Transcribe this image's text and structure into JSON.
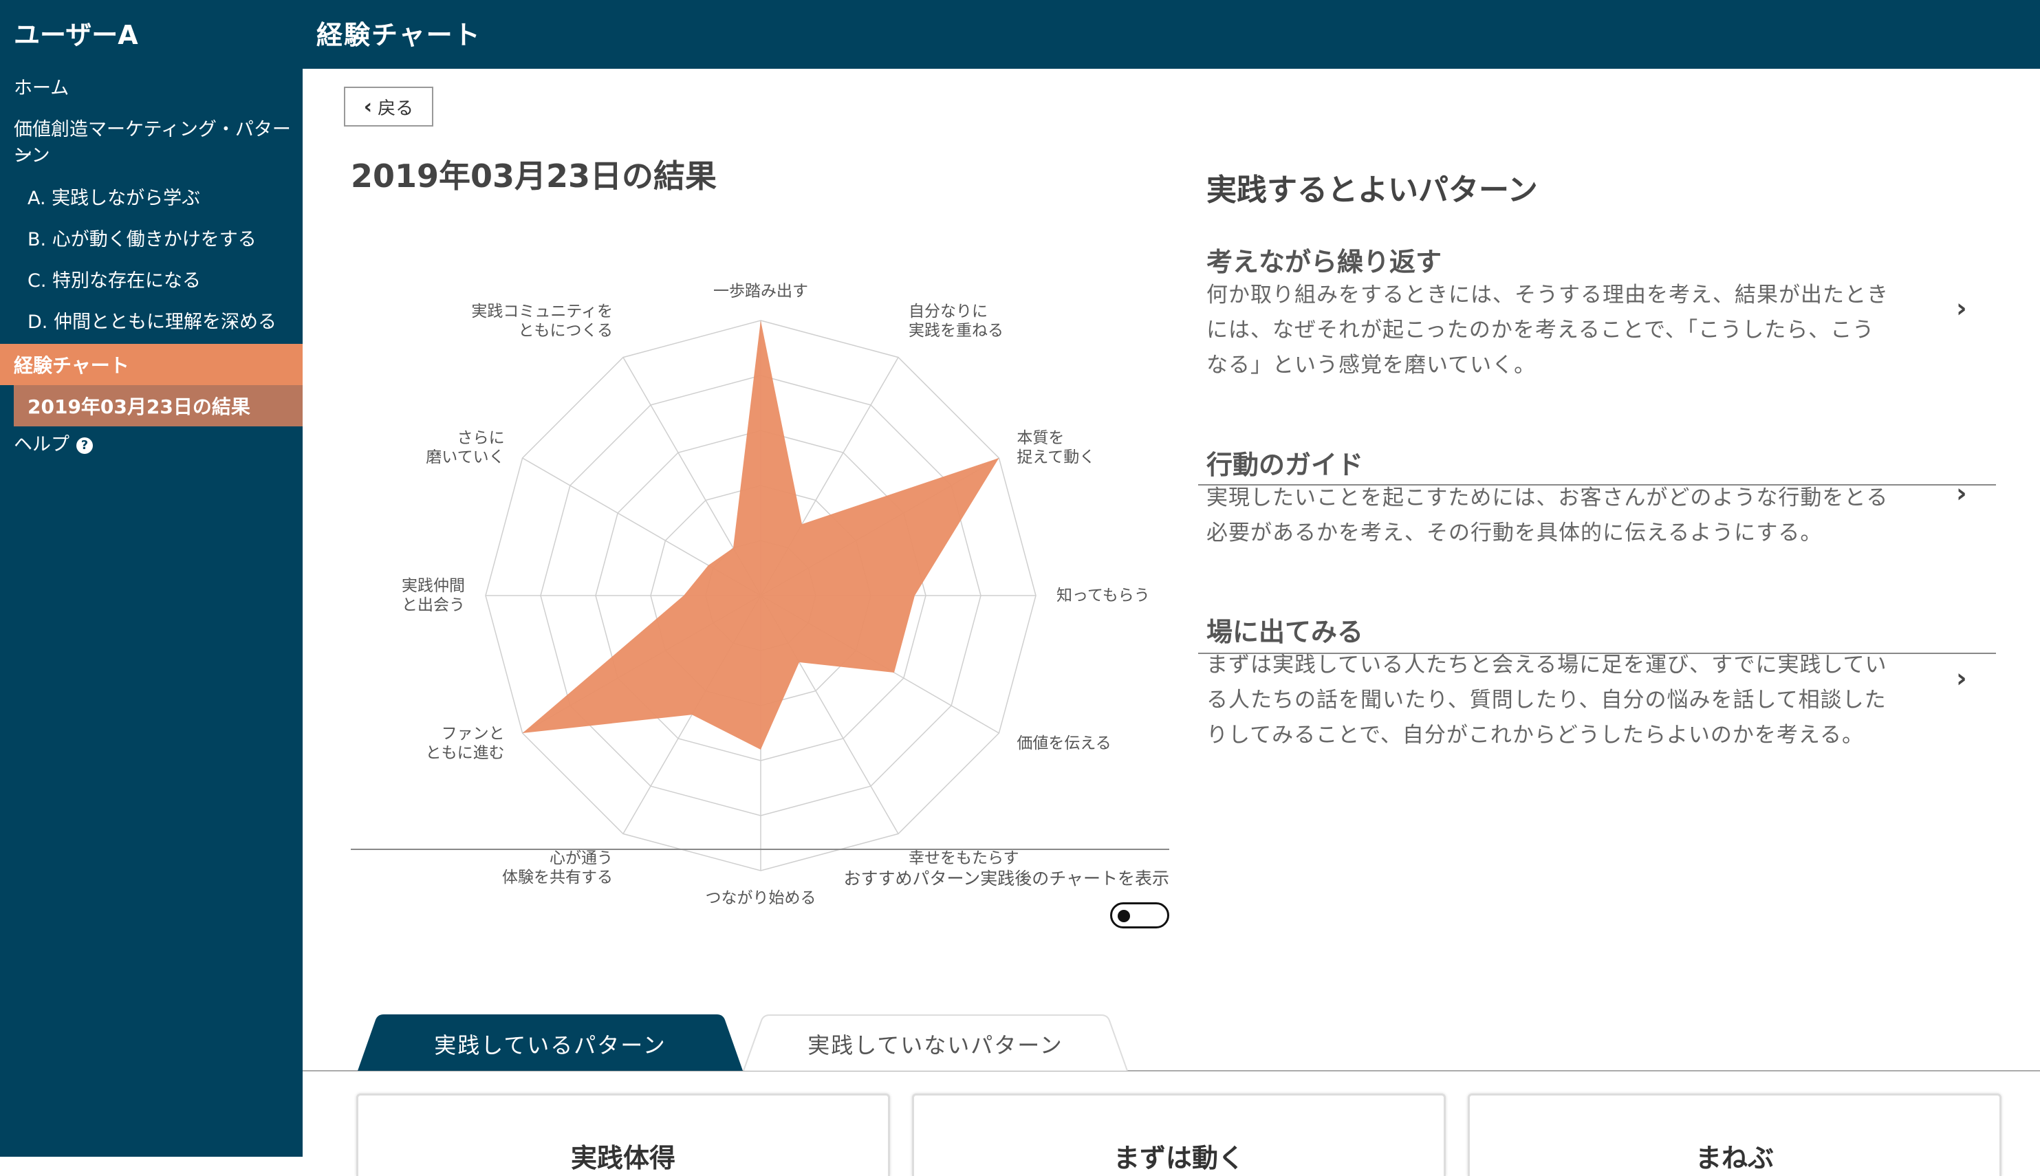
{
  "header": {
    "user_name": "ユーザーA",
    "page_title": "経験チャート"
  },
  "sidebar": {
    "home": "ホーム",
    "category": "価値創造マーケティング・パターン",
    "category_cont": "ーン",
    "items": [
      "A. 実践しながら学ぶ",
      "B. 心が動く働きかけをする",
      "C. 特別な存在になる",
      "D. 仲間とともに理解を深める"
    ],
    "chart": "経験チャート",
    "result": "2019年03月23日の結果",
    "help": "ヘルプ",
    "help_icon": "?"
  },
  "main": {
    "back_label": "戻る",
    "result_title": "2019年03月23日の結果",
    "toggle_label": "おすすめパターン実践後のチャートを表示",
    "toggle_on": false
  },
  "chart_data": {
    "type": "radar",
    "axes": [
      [
        "一歩踏み出す"
      ],
      [
        "自分なりに",
        "実践を重ねる"
      ],
      [
        "本質を",
        "捉えて動く"
      ],
      [
        "知ってもらう"
      ],
      [
        "価値を伝える"
      ],
      [
        "幸せをもたらす"
      ],
      [
        "つながり始める"
      ],
      [
        "心が通う",
        "体験を共有する"
      ],
      [
        "ファンと",
        "ともに進む"
      ],
      [
        "実践仲間",
        "と出会う"
      ],
      [
        "さらに",
        "磨いていく"
      ],
      [
        "実践コミュニティを",
        "ともにつくる"
      ]
    ],
    "values": [
      5,
      1.5,
      5,
      2.8,
      2.8,
      1.4,
      2.8,
      2.5,
      5,
      1.4,
      1.1,
      1.0
    ],
    "max": 5,
    "levels": 5,
    "fill_color": "#ea8e65",
    "grid_color": "#cfcfcf"
  },
  "recommendations": {
    "heading": "実践するとよいパターン",
    "items": [
      {
        "title": "考えながら繰り返す",
        "lines": [
          "何か取り組みをするときには、そうする理由を考え、結果が出たとき",
          "には、なぜそれが起こったのかを考えることで、「こうしたら、こう",
          "なる」という感覚を磨いていく。"
        ]
      },
      {
        "title": "行動のガイド",
        "lines": [
          "実現したいことを起こすためには、お客さんがどのような行動をとる",
          "必要があるかを考え、その行動を具体的に伝えるようにする。"
        ]
      },
      {
        "title": "場に出てみる",
        "lines": [
          "まずは実践している人たちと会える場に足を運び、すでに実践してい",
          "る人たちの話を聞いたり、質問したり、自分の悩みを話して相談した",
          "りしてみることで、自分がこれからどうしたらよいのかを考える。"
        ]
      }
    ],
    "chevron": "›"
  },
  "tabs": {
    "active": "実践しているパターン",
    "inactive": "実践していないパターン"
  },
  "cards": [
    "実践体得",
    "まずは動く",
    "まねぶ"
  ],
  "colors": {
    "navy": "#01425e",
    "accent": "#e88b5f",
    "accent_dark": "#b8775d"
  }
}
